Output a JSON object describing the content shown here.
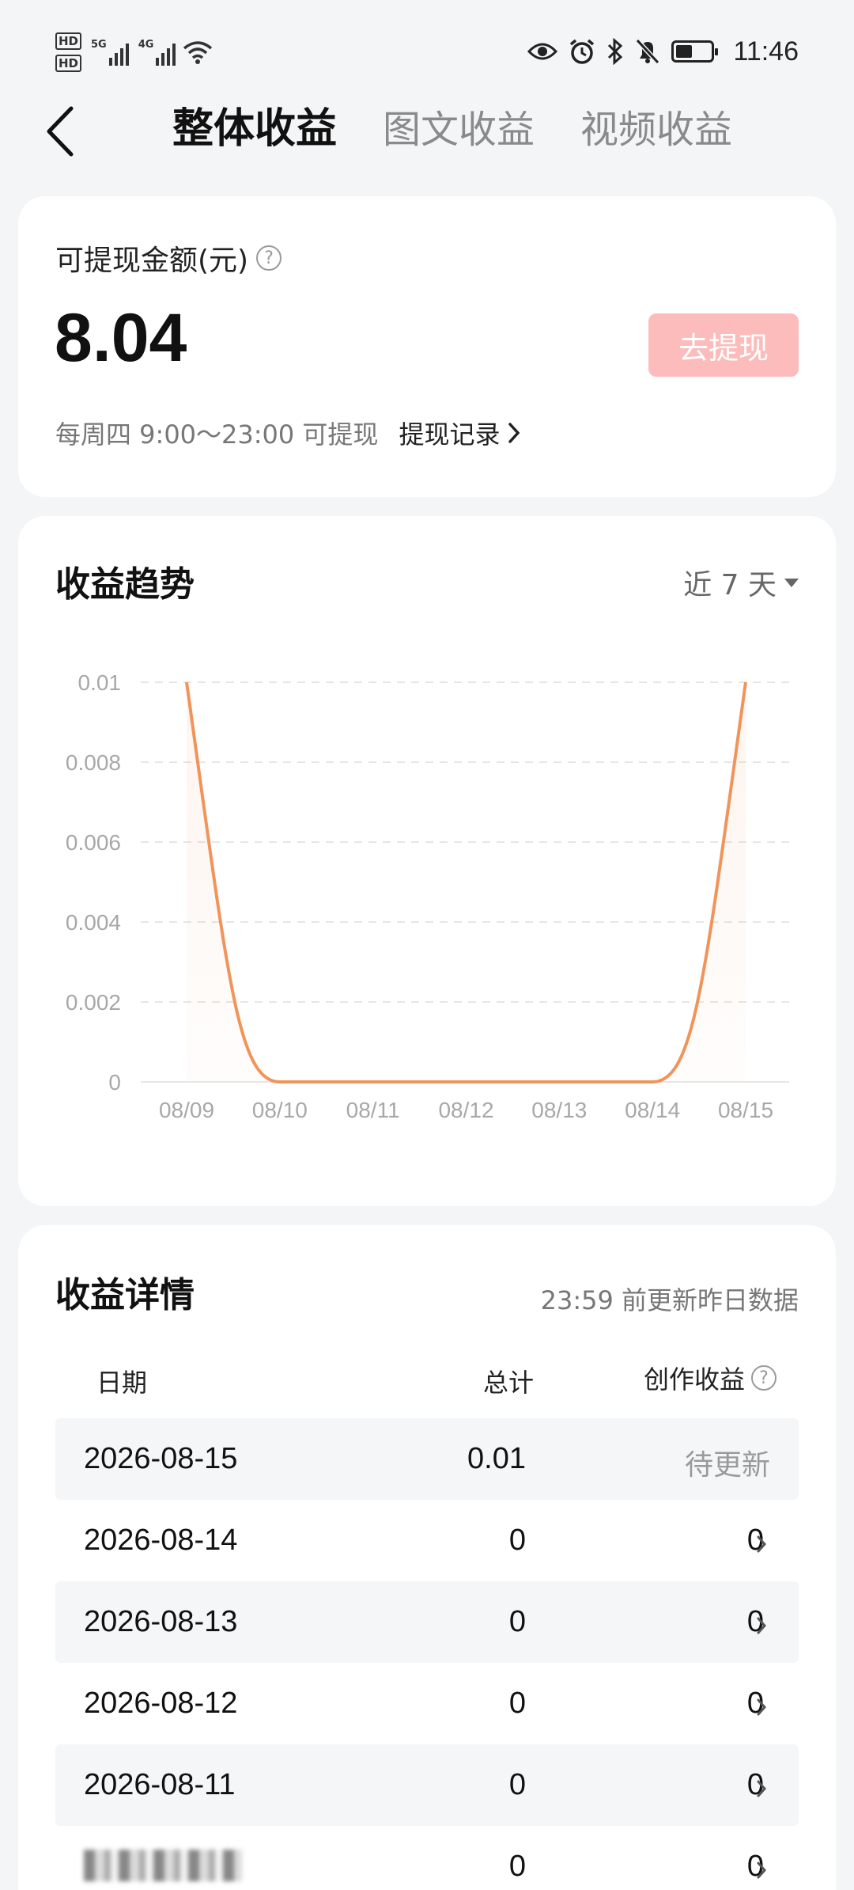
{
  "status_bar": {
    "time": "11:46",
    "net1": "5G",
    "net2": "4G",
    "hd1": "HD",
    "hd2": "HD"
  },
  "nav": {
    "tabs": [
      {
        "label": "整体收益"
      },
      {
        "label": "图文收益"
      },
      {
        "label": "视频收益"
      }
    ]
  },
  "balance": {
    "label": "可提现金额(元)",
    "amount": "8.04",
    "withdraw_button": "去提现",
    "schedule": "每周四 9:00～23:00 可提现",
    "record_link": "提现记录"
  },
  "trend": {
    "title": "收益趋势",
    "period": "近 7 天"
  },
  "chart_data": {
    "type": "line",
    "x": [
      "08/09",
      "08/10",
      "08/11",
      "08/12",
      "08/13",
      "08/14",
      "08/15"
    ],
    "series": [
      {
        "values": [
          0.01,
          0,
          0,
          0,
          0,
          0,
          0.01
        ]
      }
    ],
    "yticks": [
      "0",
      "0.002",
      "0.004",
      "0.006",
      "0.008",
      "0.01"
    ],
    "ylim": [
      0,
      0.01
    ],
    "grid": true,
    "color": "#f0945a"
  },
  "details": {
    "title": "收益详情",
    "note": "23:59 前更新昨日数据",
    "headers": {
      "date": "日期",
      "total": "总计",
      "creation": "创作收益"
    },
    "rows": [
      {
        "date": "2026-08-15",
        "total": "0.01",
        "creation": "待更新"
      },
      {
        "date": "2026-08-14",
        "total": "0",
        "creation": "0"
      },
      {
        "date": "2026-08-13",
        "total": "0",
        "creation": "0"
      },
      {
        "date": "2026-08-12",
        "total": "0",
        "creation": "0"
      },
      {
        "date": "2026-08-11",
        "total": "0",
        "creation": "0"
      },
      {
        "total": "0",
        "creation": "0"
      }
    ]
  },
  "colors": {
    "accent": "#f0945a",
    "button": "#fcbcbc",
    "background": "#f4f5f7"
  }
}
